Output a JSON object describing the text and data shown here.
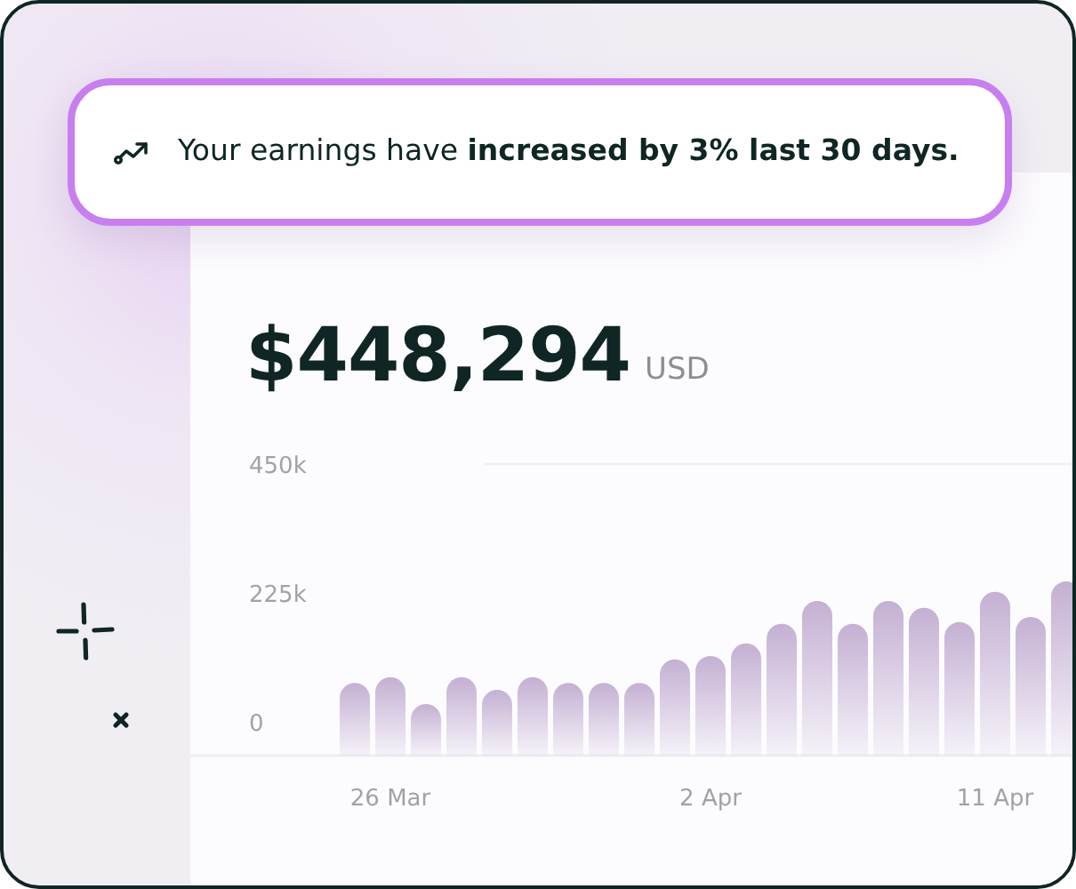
{
  "banner": {
    "text": "Your earnings have **increased by 3% last 30 days.**"
  },
  "total": {
    "amount": "$448,294",
    "currency": "USD"
  },
  "chart_data": {
    "type": "bar",
    "categories": [
      null,
      "26 Mar",
      null,
      null,
      null,
      null,
      null,
      null,
      null,
      null,
      "2 Apr",
      null,
      null,
      null,
      null,
      null,
      null,
      null,
      "11 Apr",
      null,
      null
    ],
    "series": [
      {
        "color": "#c4b0d3",
        "values": [
          68000,
          78000,
          31000,
          78000,
          56000,
          78000,
          68000,
          68000,
          68000,
          109000,
          115000,
          137000,
          171000,
          211000,
          171000,
          211000,
          199000,
          174000,
          227000,
          183000,
          245000
        ]
      }
    ],
    "ylim": [
      0,
      450000
    ],
    "yticks": [
      {
        "value": 0,
        "label": "0"
      },
      {
        "value": 225000,
        "label": "225k"
      },
      {
        "value": 450000,
        "label": "450k"
      }
    ]
  }
}
